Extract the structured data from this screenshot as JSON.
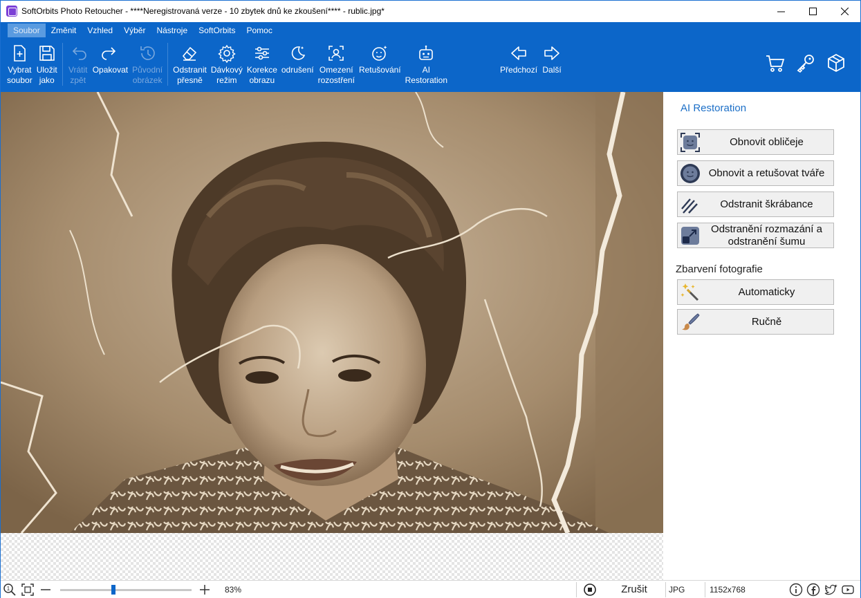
{
  "window": {
    "title": "SoftOrbits Photo Retoucher - ****Neregistrovaná verze - 10 zbytek dnů ke zkoušení**** - rublic.jpg*"
  },
  "menu": [
    "Soubor",
    "Změnit",
    "Vzhled",
    "Výběr",
    "Nástroje",
    "SoftOrbits",
    "Pomoc"
  ],
  "toolbar": {
    "open": {
      "l1": "Vybrat",
      "l2": "soubor"
    },
    "save": {
      "l1": "Uložit",
      "l2": "jako"
    },
    "undo": {
      "l1": "Vrátit",
      "l2": "zpět"
    },
    "redo": {
      "l1": "Opakovat"
    },
    "original": {
      "l1": "Původní",
      "l2": "obrázek"
    },
    "erase": {
      "l1": "Odstranit",
      "l2": "přesně"
    },
    "batch": {
      "l1": "Dávkový",
      "l2": "režim"
    },
    "correct": {
      "l1": "Korekce",
      "l2": "obrazu"
    },
    "denoise": {
      "l1": "odrušení"
    },
    "blur": {
      "l1": "Omezení",
      "l2": "rozostření"
    },
    "retouch": {
      "l1": "Retušování"
    },
    "ai": {
      "l1": "AI",
      "l2": "Restoration"
    },
    "prev": {
      "l1": "Předchozí"
    },
    "next": {
      "l1": "Další"
    }
  },
  "panel": {
    "title": "AI Restoration",
    "buttons": [
      {
        "label": "Obnovit obličeje"
      },
      {
        "label": "Obnovit a retušovat tváře"
      },
      {
        "label": "Odstranit škrábance"
      },
      {
        "label1": "Odstranění rozmazání a",
        "label2": "odstranění šumu"
      }
    ],
    "coloring_title": "Zbarvení fotografie",
    "coloring_buttons": [
      {
        "label": "Automaticky"
      },
      {
        "label": "Ručně"
      }
    ]
  },
  "status": {
    "zoom": "83%",
    "zoom_fraction": 0.4,
    "cancel": "Zrušit",
    "format": "JPG",
    "dimensions": "1152x768"
  }
}
